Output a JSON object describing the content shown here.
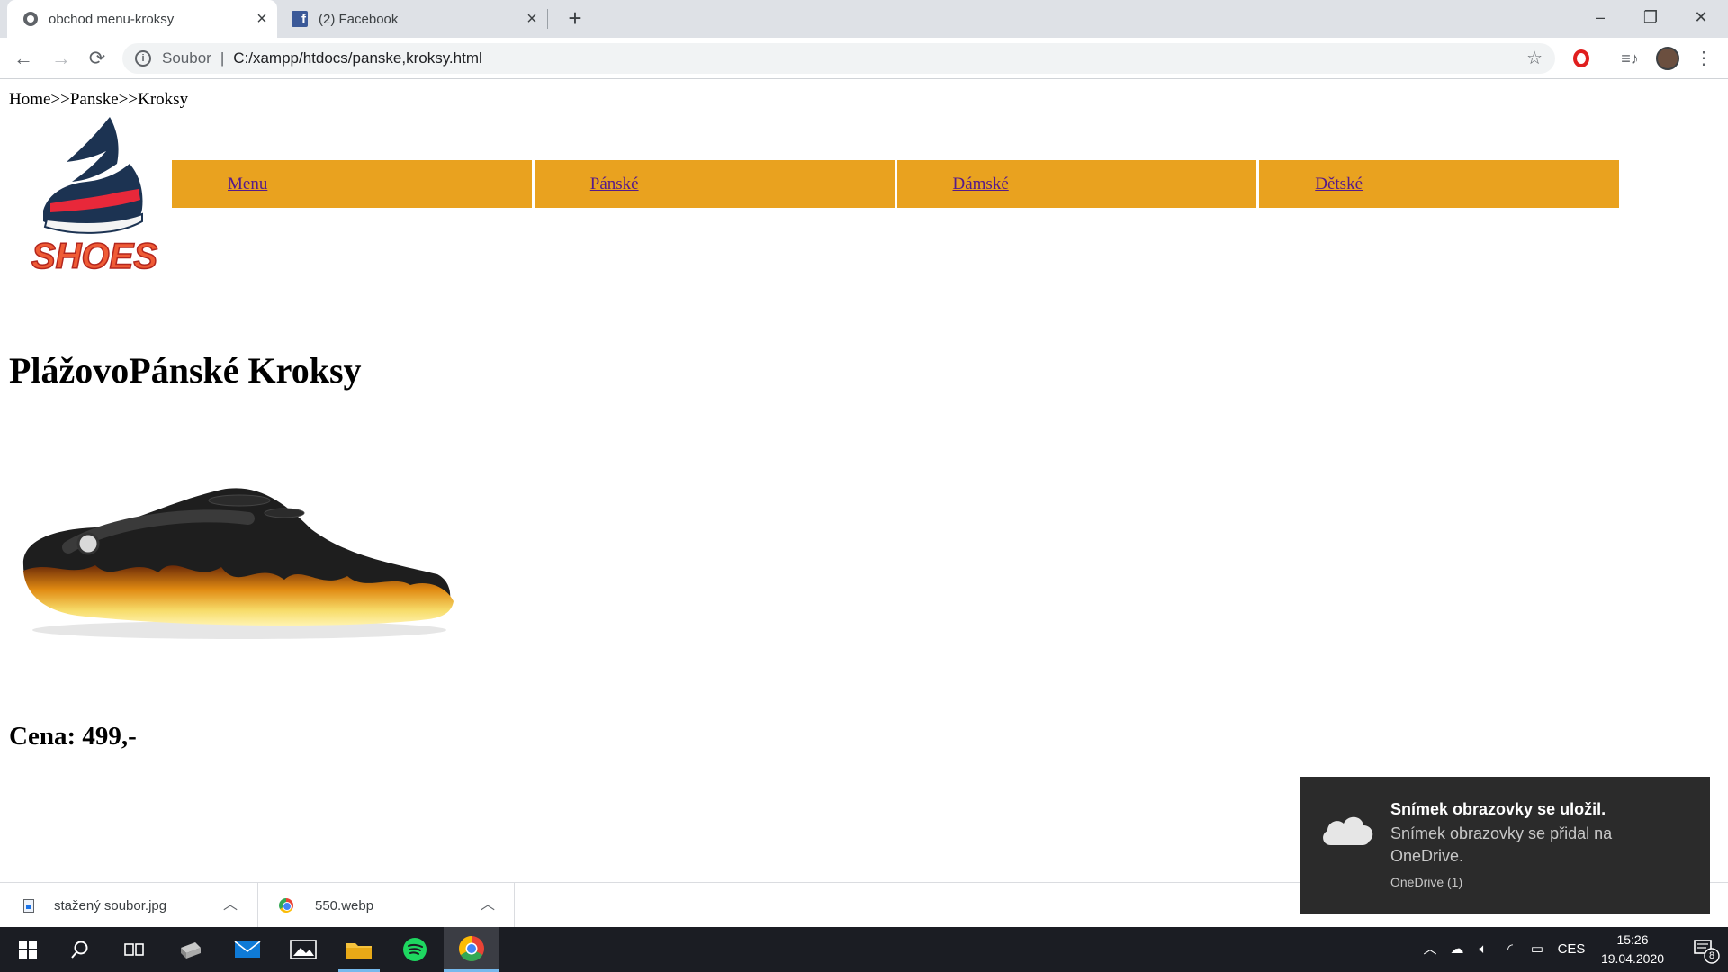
{
  "browser": {
    "tabs": [
      {
        "title": "obchod menu-kroksy",
        "icon": "globe-icon",
        "active": true
      },
      {
        "title": "(2) Facebook",
        "icon": "facebook-icon",
        "active": false
      }
    ],
    "new_tab_label": "+",
    "window_controls": {
      "minimize": "–",
      "maximize": "❐",
      "close": "✕"
    },
    "nav": {
      "back": "←",
      "forward": "→",
      "reload": "⟳"
    },
    "address": {
      "scheme": "Soubor",
      "separator": "|",
      "url": "C:/xampp/htdocs/panske,kroksy.html"
    },
    "extensions": [
      "star-icon",
      "opera-icon",
      "media-control-icon",
      "profile-avatar",
      "menu-icon"
    ]
  },
  "page": {
    "breadcrumb": "Home>>Panske>>Kroksy",
    "logo_text": "SHOES",
    "menu": [
      "Menu",
      "Pánské",
      "Dámské",
      "Dětské"
    ],
    "heading": "PlážovoPánské Kroksy",
    "price": "Cena: 499,-",
    "colors": {
      "menu_bg": "#e9a21f",
      "link": "#551a8b"
    }
  },
  "downloads": [
    {
      "name": "stažený soubor.jpg",
      "icon": "file-image-icon"
    },
    {
      "name": "550.webp",
      "icon": "chrome-icon"
    }
  ],
  "toast": {
    "title": "Snímek obrazovky se uložil.",
    "body": "Snímek obrazovky se přidal na OneDrive.",
    "source": "OneDrive (1)",
    "icon": "onedrive-cloud-icon"
  },
  "taskbar": {
    "apps": [
      "start-icon",
      "search-icon",
      "task-view-icon",
      "scanner-icon",
      "mail-icon",
      "photos-icon",
      "file-explorer-icon",
      "spotify-icon",
      "chrome-icon"
    ],
    "language": "CES",
    "time": "15:26",
    "date": "19.04.2020",
    "notification_count": "8"
  }
}
